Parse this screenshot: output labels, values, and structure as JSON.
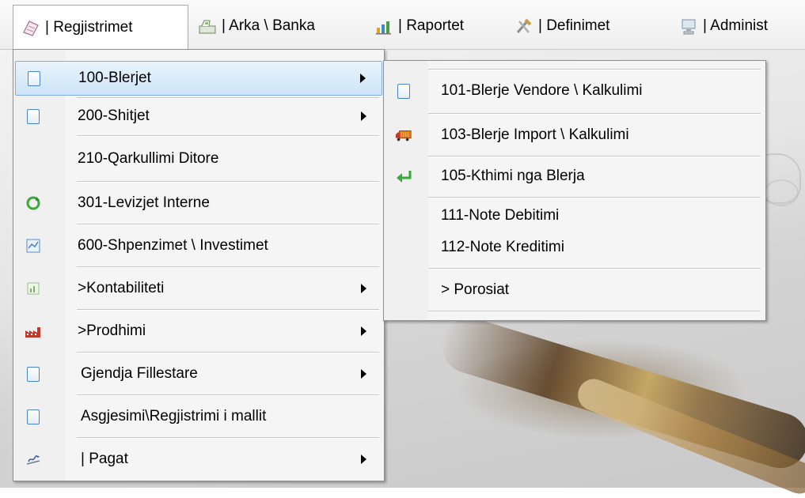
{
  "menubar": {
    "items": [
      {
        "label": "| Regjistrimet",
        "icon": "register-icon",
        "open": true
      },
      {
        "label": "| Arka \\ Banka",
        "icon": "cash-register-icon"
      },
      {
        "label": "| Raportet",
        "icon": "bar-chart-icon"
      },
      {
        "label": "| Definimet",
        "icon": "tools-icon"
      },
      {
        "label": "| Administ",
        "icon": "computer-icon"
      }
    ]
  },
  "main_menu": {
    "items": [
      {
        "label": "100-Blerjet",
        "icon": "document-icon",
        "submenu": true,
        "selected": true
      },
      {
        "label": "200-Shitjet",
        "icon": "document-icon",
        "submenu": true
      },
      {
        "label": "210-Qarkullimi Ditore",
        "icon": "",
        "submenu": false
      },
      {
        "label": "301-Levizjet Interne",
        "icon": "recycle-icon",
        "submenu": false
      },
      {
        "label": "600-Shpenzimet \\ Investimet",
        "icon": "expenses-icon",
        "submenu": false
      },
      {
        "label": ">Kontabiliteti",
        "icon": "accounting-icon",
        "submenu": true
      },
      {
        "label": ">Prodhimi",
        "icon": "factory-icon",
        "submenu": true
      },
      {
        "label": "Gjendja Fillestare",
        "icon": "document-icon",
        "submenu": true
      },
      {
        "label": "Asgjesimi\\Regjistrimi i mallit",
        "icon": "document-icon",
        "submenu": false
      },
      {
        "label": "| Pagat",
        "icon": "signature-icon",
        "submenu": true
      }
    ]
  },
  "sub_menu": {
    "items": [
      {
        "label": "101-Blerje Vendore \\ Kalkulimi",
        "icon": "document-icon"
      },
      {
        "label": "103-Blerje Import \\ Kalkulimi",
        "icon": "truck-icon"
      },
      {
        "label": "105-Kthimi nga Blerja",
        "icon": "return-arrow-icon"
      },
      {
        "label": "111-Note Debitimi",
        "icon": ""
      },
      {
        "label": "112-Note Kreditimi",
        "icon": ""
      },
      {
        "label": "> Porosiat",
        "icon": ""
      }
    ]
  },
  "colors": {
    "selection_border": "#84acdd",
    "selection_fill": "#cde4f7",
    "menu_bg": "#f5f5f5"
  }
}
